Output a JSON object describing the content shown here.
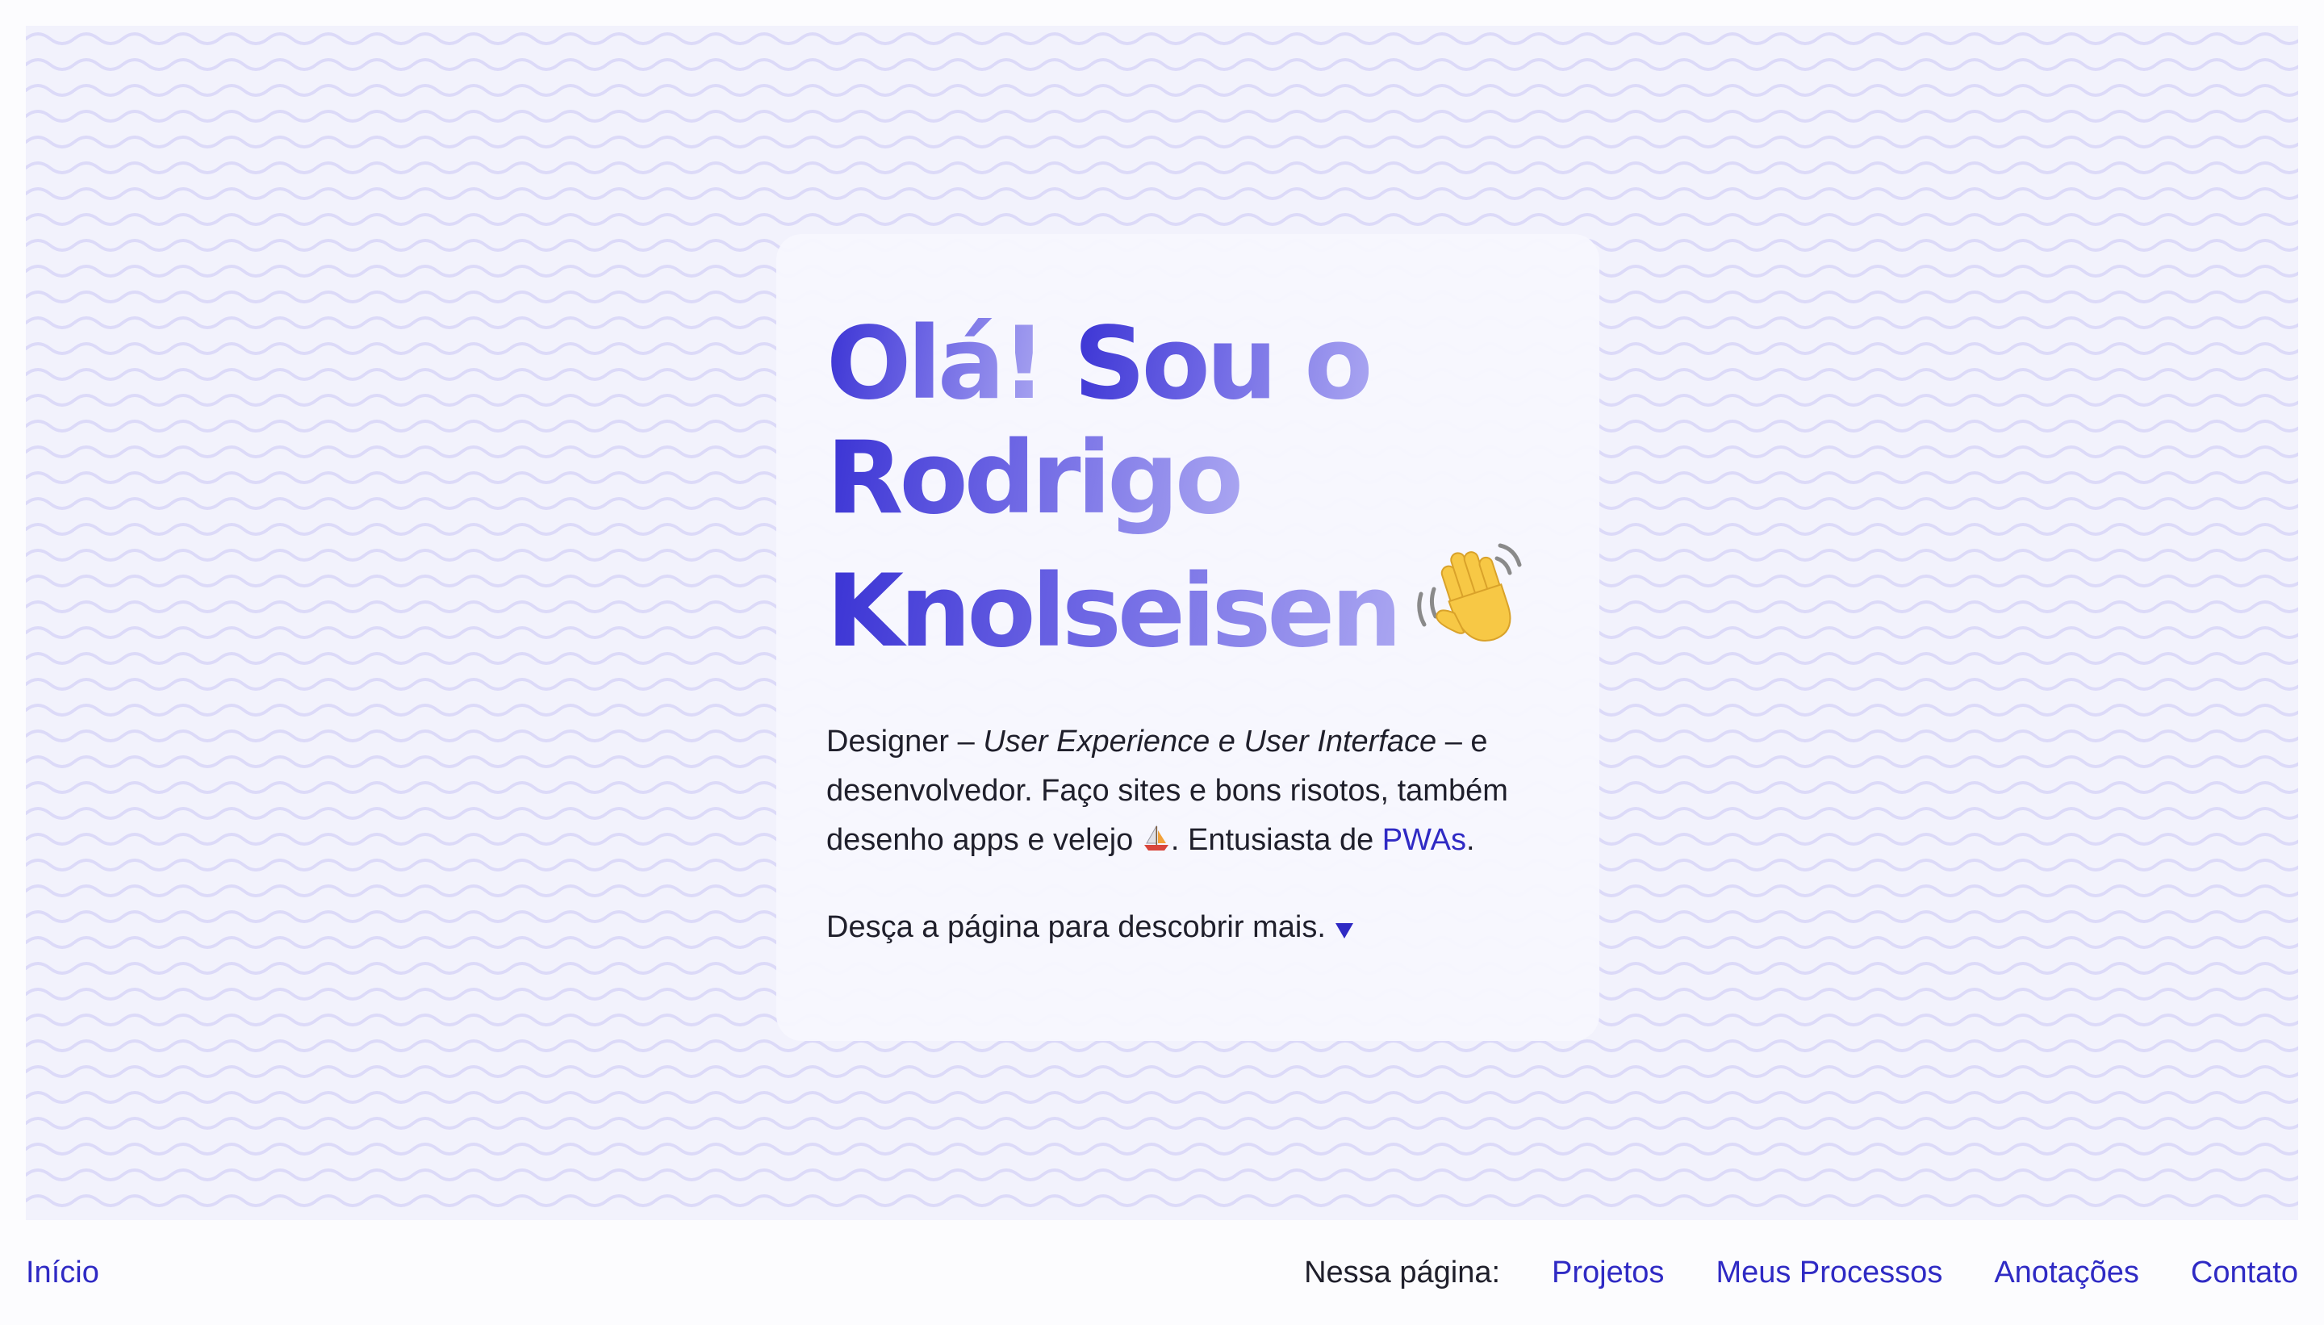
{
  "hero": {
    "headline_line1_a": "Olá!",
    "headline_line1_b": "Sou o",
    "headline_line2": "Rodrigo",
    "headline_line3": "Knolseisen",
    "intro": {
      "part1": "Designer – ",
      "italic": "User Experience e User Interface",
      "part2": " – e desenvolvedor. Faço sites e bons risotos, também desenho apps e velejo ",
      "part3": ". Entusiasta de ",
      "link": "PWAs",
      "part4": "."
    },
    "more_text": "Desça a página para descobrir mais."
  },
  "icons": {
    "wave": "waving-hand-icon",
    "boat": "sailboat-icon",
    "arrow": "triangle-down-icon"
  },
  "nav": {
    "home": "Início",
    "on_page_label": "Nessa página:",
    "links": [
      "Projetos",
      "Meus Processos",
      "Anotações",
      "Contato"
    ]
  },
  "colors": {
    "accent": "#2f2ac4",
    "hero_background": "#f2f2fc",
    "wave_lines": "#dcdaf8",
    "text": "#1f1f2b"
  }
}
